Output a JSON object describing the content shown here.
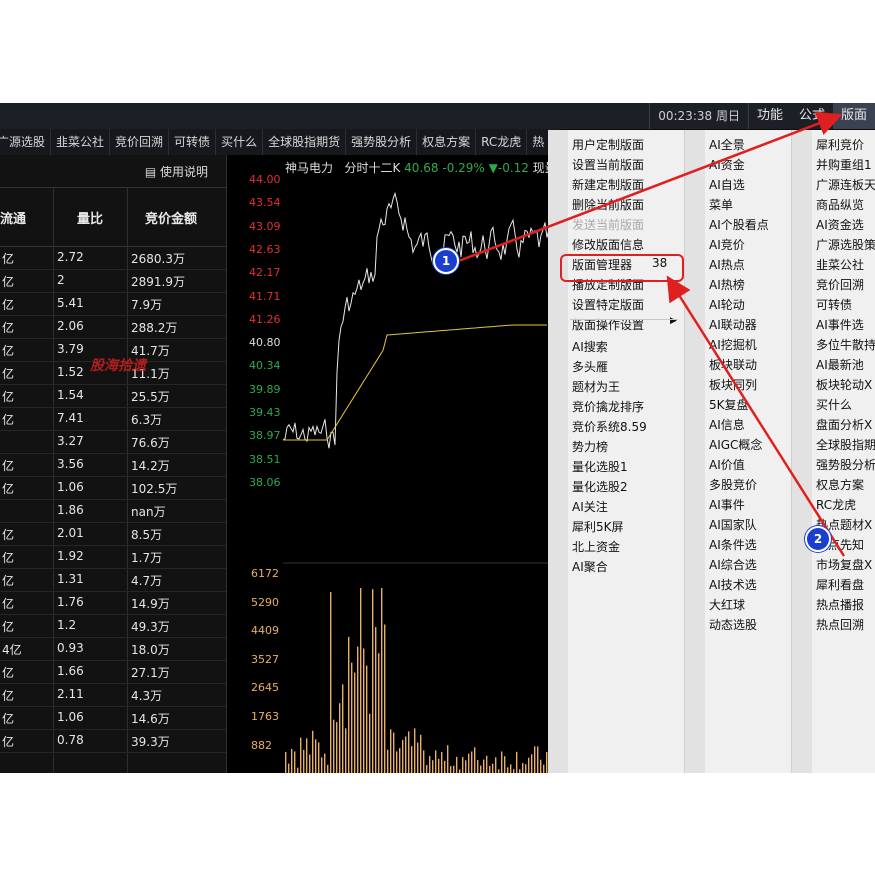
{
  "topbar": {
    "time": "00:23:38 周日",
    "menus": [
      "功能",
      "公式",
      "版面"
    ],
    "active_menu": "版面"
  },
  "tabs": [
    "广源选股",
    "韭菜公社",
    "竞价回溯",
    "可转债",
    "买什么",
    "全球股指期货",
    "强势股分析",
    "权息方案",
    "RC龙虎",
    "热"
  ],
  "left_panel": {
    "manual_label": "使用说明",
    "columns": [
      "流通",
      "量比",
      "竞价金额"
    ],
    "rows": [
      [
        "亿",
        "2.72",
        "2680.3万"
      ],
      [
        "亿",
        "2",
        "2891.9万"
      ],
      [
        "亿",
        "5.41",
        "7.9万"
      ],
      [
        "亿",
        "2.06",
        "288.2万"
      ],
      [
        "亿",
        "3.79",
        "41.7万"
      ],
      [
        "亿",
        "1.52",
        "11.1万"
      ],
      [
        "亿",
        "1.54",
        "25.5万"
      ],
      [
        "亿",
        "7.41",
        "6.3万"
      ],
      [
        "",
        "3.27",
        "76.6万"
      ],
      [
        "亿",
        "3.56",
        "14.2万"
      ],
      [
        "亿",
        "1.06",
        "102.5万"
      ],
      [
        "",
        "1.86",
        "nan万"
      ],
      [
        "亿",
        "2.01",
        "8.5万"
      ],
      [
        "亿",
        "1.92",
        "1.7万"
      ],
      [
        "亿",
        "1.31",
        "4.7万"
      ],
      [
        "亿",
        "1.76",
        "14.9万"
      ],
      [
        "亿",
        "1.2",
        "49.3万"
      ],
      [
        "4亿",
        "0.93",
        "18.0万"
      ],
      [
        "亿",
        "1.66",
        "27.1万"
      ],
      [
        "亿",
        "2.11",
        "4.3万"
      ],
      [
        "亿",
        "1.06",
        "14.6万"
      ],
      [
        "亿",
        "0.78",
        "39.3万"
      ]
    ],
    "watermark": "股海拾遗"
  },
  "chart": {
    "stock_name": "神马电力",
    "period": "分时十二K",
    "price": "40.68",
    "pct_change": "-0.29%",
    "change": "▼-0.12",
    "extra": "现量",
    "price_ticks": [
      "44.00",
      "43.54",
      "43.09",
      "42.63",
      "42.17",
      "41.71",
      "41.26",
      "40.80",
      "40.34",
      "39.89",
      "39.43",
      "38.97",
      "38.51",
      "38.06"
    ],
    "volume_ticks": [
      "6172",
      "5290",
      "4409",
      "3527",
      "2645",
      "1763",
      "882"
    ],
    "colors": {
      "up": "#e03030",
      "down": "#2fa84f",
      "flat": "#dddddd",
      "volume": "#e8b060",
      "avg_line": "#e5c542"
    }
  },
  "menu": {
    "col1": [
      "用户定制版面",
      "设置当前版面",
      "新建定制版面",
      "删除当前版面",
      "发送当前版面",
      "修改版面信息",
      "版面管理器",
      "播放定制版面",
      "设置特定版面",
      "版面操作设置",
      "AI搜索",
      "多头雁",
      "题材为王",
      "竞价擒龙排序",
      "竞价系统8.59",
      "势力榜",
      "量化选股1",
      "量化选股2",
      "AI关注",
      "犀利5K屏",
      "北上资金",
      "AI聚合"
    ],
    "col1_shortcut": "38",
    "col2": [
      "AI全景",
      "AI资金",
      "AI自选",
      "菜单",
      "AI个股看点",
      "AI竞价",
      "AI热点",
      "AI热榜",
      "AI轮动",
      "AI联动器",
      "AI挖掘机",
      "板块联动",
      "板块同列",
      "5K复盘",
      "AI信息",
      "AIGC概念",
      "AI价值",
      "多股竞价",
      "AI事件",
      "AI国家队",
      "AI条件选",
      "AI综合选",
      "AI技术选",
      "大红球",
      "动态选股"
    ],
    "col3": [
      "犀利竞价",
      "并购重组1",
      "广源连板天",
      "商品纵览",
      "AI资金选",
      "广源选股策",
      "韭菜公社",
      "竞价回溯",
      "可转债",
      "AI事件选",
      "多位牛散持",
      "AI最新池",
      "板块轮动X",
      "买什么",
      "盘面分析X",
      "全球股指期",
      "强势股分析",
      "权息方案",
      "RC龙虎",
      "热点题材X",
      "热点先知",
      "市场复盘X",
      "犀利看盘",
      "热点播报",
      "热点回溯"
    ]
  },
  "annotations": {
    "badge1": "1",
    "badge2": "2"
  }
}
